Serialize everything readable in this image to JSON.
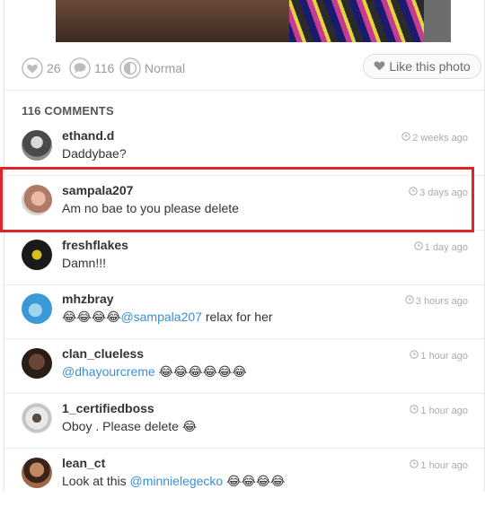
{
  "stats": {
    "likes": "26",
    "comments": "116",
    "filter": "Normal",
    "like_button": "Like this photo"
  },
  "comments_header": "116 COMMENTS",
  "comments": [
    {
      "username": "ethand.d",
      "text": "Daddybae?",
      "mention": "",
      "after": "",
      "time": "2 weeks ago",
      "avatar_color": "#7a7a7a"
    },
    {
      "username": "sampala207",
      "text": "Am no bae to you please delete",
      "mention": "",
      "after": "",
      "time": "3 days ago",
      "avatar_color": "#c98d78"
    },
    {
      "username": "freshflakes",
      "text": "Damn!!!",
      "mention": "",
      "after": "",
      "time": "1 day ago",
      "avatar_color": "#1a1a1a"
    },
    {
      "username": "mhzbray",
      "text": "😂😂😂😂",
      "mention": "@sampala207",
      "after": " relax for her",
      "time": "3 hours ago",
      "avatar_color": "#3b9ad6"
    },
    {
      "username": "clan_clueless",
      "text": "",
      "mention": "@dhayourcreme",
      "after": " 😂😂😂😂😂😂",
      "time": "1 hour ago",
      "avatar_color": "#4a3328"
    },
    {
      "username": "1_certifiedboss",
      "text": "Oboy . Please delete 😂",
      "mention": "",
      "after": "",
      "time": "1 hour ago",
      "avatar_color": "#b9b9b9"
    },
    {
      "username": "lean_ct",
      "text": "Look at this ",
      "mention": "@minnielegecko",
      "after": " 😂😂😂😂",
      "time": "1 hour ago",
      "avatar_color": "#8a5a3c"
    }
  ],
  "highlight_color": "#e0242b",
  "accent_link": "#3a8fd6"
}
